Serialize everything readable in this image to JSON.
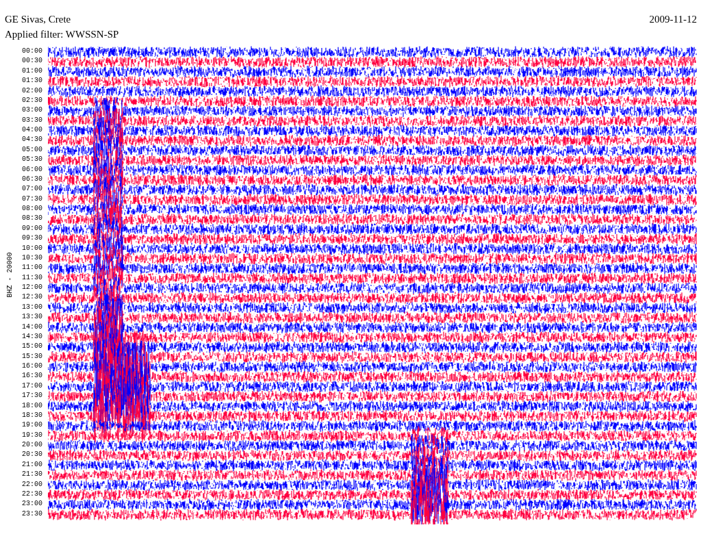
{
  "header": {
    "station": "GE Sivas, Crete",
    "date": "2009-11-12",
    "filter": "Applied filter: WWSSN-SP"
  },
  "axis_label": "BHZ - 20000",
  "traces": [
    {
      "time": "00:00",
      "color": "#0000ff"
    },
    {
      "time": "00:30",
      "color": "#ff0040"
    },
    {
      "time": "01:00",
      "color": "#0000ff"
    },
    {
      "time": "01:30",
      "color": "#ff0040"
    },
    {
      "time": "02:00",
      "color": "#0000ff"
    },
    {
      "time": "02:30",
      "color": "#ff0040"
    },
    {
      "time": "03:00",
      "color": "#0000ff"
    },
    {
      "time": "03:30",
      "color": "#ff0040"
    },
    {
      "time": "04:00",
      "color": "#0000ff"
    },
    {
      "time": "04:30",
      "color": "#ff0040"
    },
    {
      "time": "05:00",
      "color": "#0000ff"
    },
    {
      "time": "05:30",
      "color": "#ff0040"
    },
    {
      "time": "06:00",
      "color": "#0000ff"
    },
    {
      "time": "06:30",
      "color": "#ff0040"
    },
    {
      "time": "07:00",
      "color": "#0000ff"
    },
    {
      "time": "07:30",
      "color": "#ff0040"
    },
    {
      "time": "08:00",
      "color": "#0000ff"
    },
    {
      "time": "08:30",
      "color": "#ff0040"
    },
    {
      "time": "09:00",
      "color": "#0000ff"
    },
    {
      "time": "09:30",
      "color": "#ff0040"
    },
    {
      "time": "10:00",
      "color": "#0000ff"
    },
    {
      "time": "10:30",
      "color": "#ff0040"
    },
    {
      "time": "11:00",
      "color": "#0000ff"
    },
    {
      "time": "11:30",
      "color": "#ff0040"
    },
    {
      "time": "12:00",
      "color": "#0000ff"
    },
    {
      "time": "12:30",
      "color": "#ff0040"
    },
    {
      "time": "13:00",
      "color": "#0000ff"
    },
    {
      "time": "13:30",
      "color": "#ff0040"
    },
    {
      "time": "14:00",
      "color": "#0000ff"
    },
    {
      "time": "14:30",
      "color": "#ff0040"
    },
    {
      "time": "15:00",
      "color": "#0000ff"
    },
    {
      "time": "15:30",
      "color": "#ff0040"
    },
    {
      "time": "16:00",
      "color": "#0000ff"
    },
    {
      "time": "16:30",
      "color": "#ff0040"
    },
    {
      "time": "17:00",
      "color": "#0000ff"
    },
    {
      "time": "17:30",
      "color": "#ff0040"
    },
    {
      "time": "18:00",
      "color": "#0000ff"
    },
    {
      "time": "18:30",
      "color": "#ff0040"
    },
    {
      "time": "19:00",
      "color": "#0000ff"
    },
    {
      "time": "19:30",
      "color": "#ff0040"
    },
    {
      "time": "20:00",
      "color": "#0000ff"
    },
    {
      "time": "20:30",
      "color": "#ff0040"
    },
    {
      "time": "21:00",
      "color": "#0000ff"
    },
    {
      "time": "21:30",
      "color": "#ff0040"
    },
    {
      "time": "22:00",
      "color": "#0000ff"
    },
    {
      "time": "22:30",
      "color": "#ff0040"
    },
    {
      "time": "23:00",
      "color": "#0000ff"
    },
    {
      "time": "23:30",
      "color": "#ff0040"
    }
  ]
}
